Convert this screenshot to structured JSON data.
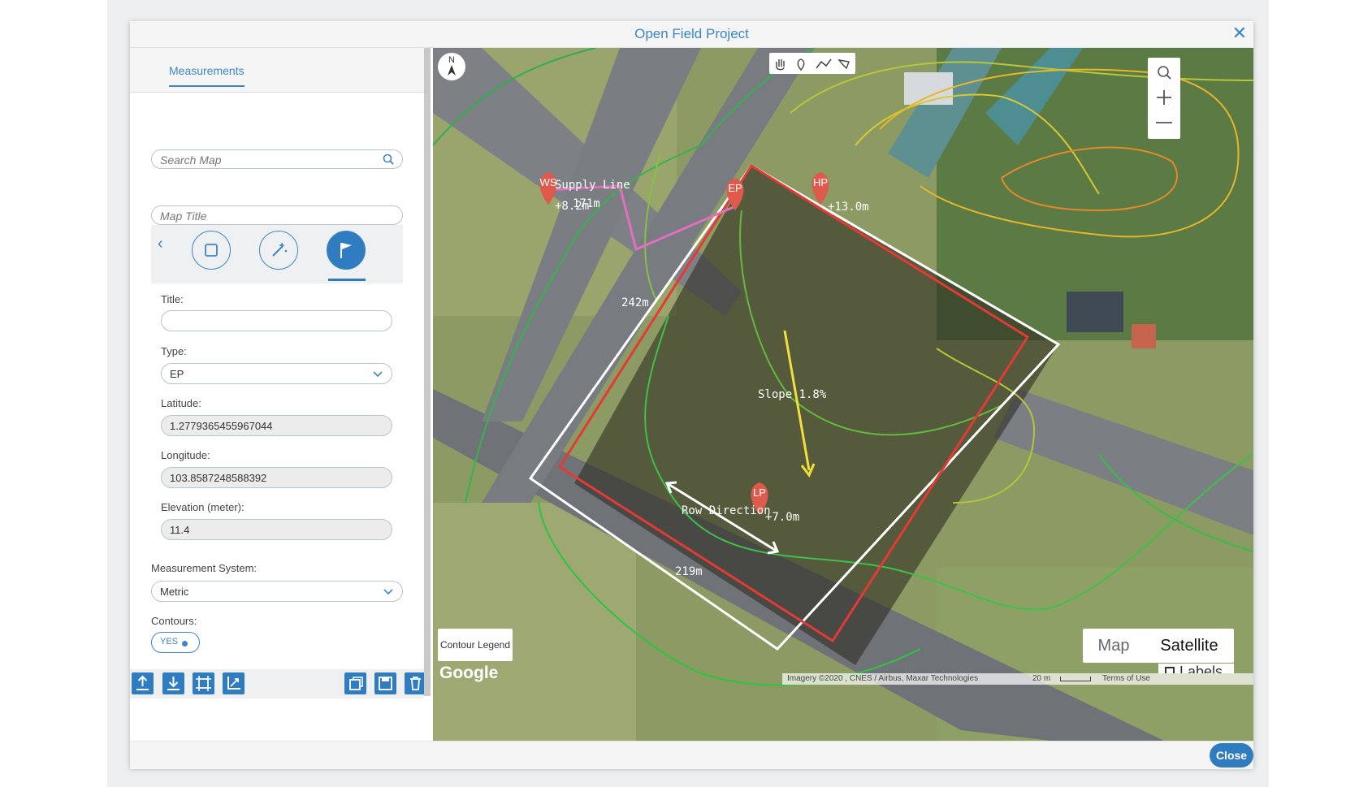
{
  "window": {
    "title": "Open Field Project",
    "close_icon": "✕"
  },
  "tabs": [
    {
      "label": "Measurements"
    }
  ],
  "search": {
    "placeholder": "Search Map"
  },
  "map_title": {
    "placeholder": "Map Title"
  },
  "tools": {
    "back": "‹"
  },
  "form": {
    "title_label": "Title:",
    "title_value": "",
    "type_label": "Type:",
    "type_value": "EP",
    "latitude_label": "Latitude:",
    "latitude_value": "1.2779365455967044",
    "longitude_label": "Longitude:",
    "longitude_value": "103.8587248588392",
    "elevation_label": "Elevation (meter):",
    "elevation_value": "11.4",
    "measurement_label": "Measurement System:",
    "measurement_value": "Metric",
    "contours_label": "Contours:",
    "contours_value": "YES"
  },
  "map": {
    "markers": [
      {
        "label": "WS",
        "elevation": "+8.2m"
      },
      {
        "label": "EP",
        "elevation": ""
      },
      {
        "label": "HP",
        "elevation": "+13.0m"
      },
      {
        "label": "LP",
        "elevation": "+7.0m"
      }
    ],
    "supply_line_label": "Supply Line",
    "supply_length": "171m",
    "length_242": "242m",
    "length_219": "219m",
    "slope_label": "Slope 1.8%",
    "row_direction_label": "Row Direction",
    "contour_legend": "Contour Legend",
    "google_logo": "Google",
    "attribution": "Imagery ©2020 , CNES / Airbus, Maxar Technologies",
    "scale_label": "20 m",
    "terms": "Terms of Use",
    "map_type": [
      "Map",
      "Satellite"
    ],
    "labels_option": "Labels",
    "compass_letter": "N"
  },
  "footer": {
    "close_label": "Close"
  },
  "colors": {
    "accent": "#2f7cc0",
    "boundary": "#e53935",
    "marker": "#e05a4c",
    "supply_line": "#e06fbf",
    "slope_arrow": "#f2e03a"
  }
}
